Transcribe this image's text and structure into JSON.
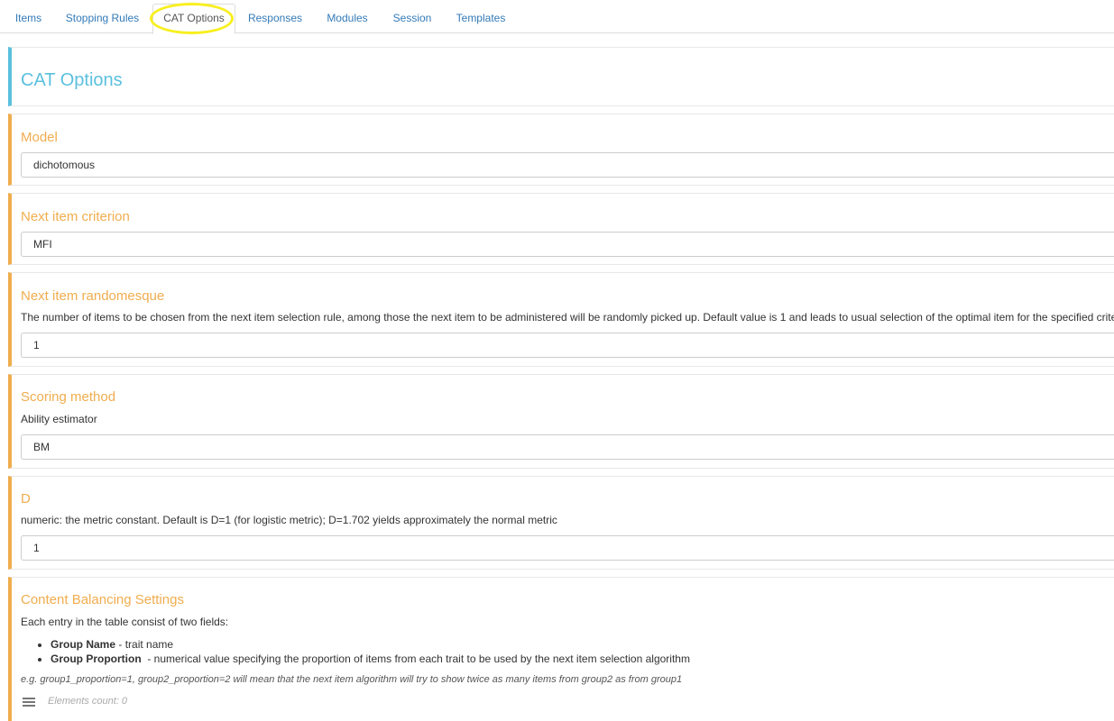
{
  "tabs": [
    {
      "label": "Items"
    },
    {
      "label": "Stopping Rules"
    },
    {
      "label": "CAT Options"
    },
    {
      "label": "Responses"
    },
    {
      "label": "Modules"
    },
    {
      "label": "Session"
    },
    {
      "label": "Templates"
    }
  ],
  "active_tab": "CAT Options",
  "highlight_color": "#f8ef20",
  "page_title": "CAT Options",
  "model": {
    "heading": "Model",
    "value": "dichotomous"
  },
  "next_item_criterion": {
    "heading": "Next item criterion",
    "value": "MFI"
  },
  "randomesque": {
    "heading": "Next item randomesque",
    "description": "The number of items to be chosen from the next item selection rule, among those the next item to be administered will be randomly picked up. Default value is 1 and leads to usual selection of the optimal item for the specified criterion.",
    "value": "1"
  },
  "scoring": {
    "heading": "Scoring method",
    "description": "Ability estimator",
    "value": "BM"
  },
  "d_constant": {
    "heading": "D",
    "description": "numeric: the metric constant. Default is D=1 (for logistic metric); D=1.702 yields approximately the normal metric",
    "value": "1"
  },
  "content_balancing": {
    "heading": "Content Balancing Settings",
    "description": "Each entry in the table consist of two fields:",
    "fields": [
      {
        "name": "Group Name",
        "sep": " - ",
        "desc": "trait name"
      },
      {
        "name": "Group Proportion",
        "sep": "  - ",
        "desc": "numerical value specifying the proportion of items from each trait to be used by the next item selection algorithm"
      }
    ],
    "example": "e.g. group1_proportion=1, group2_proportion=2 will mean that the next item algorithm will try to show twice as many items from group2 as from group1",
    "elements_count_label": "Elements count: 0",
    "list_icon": "list-icon"
  },
  "colors": {
    "link": "#337ab7",
    "title_accent": "#5bc0de",
    "section_accent": "#f0ad4e"
  }
}
